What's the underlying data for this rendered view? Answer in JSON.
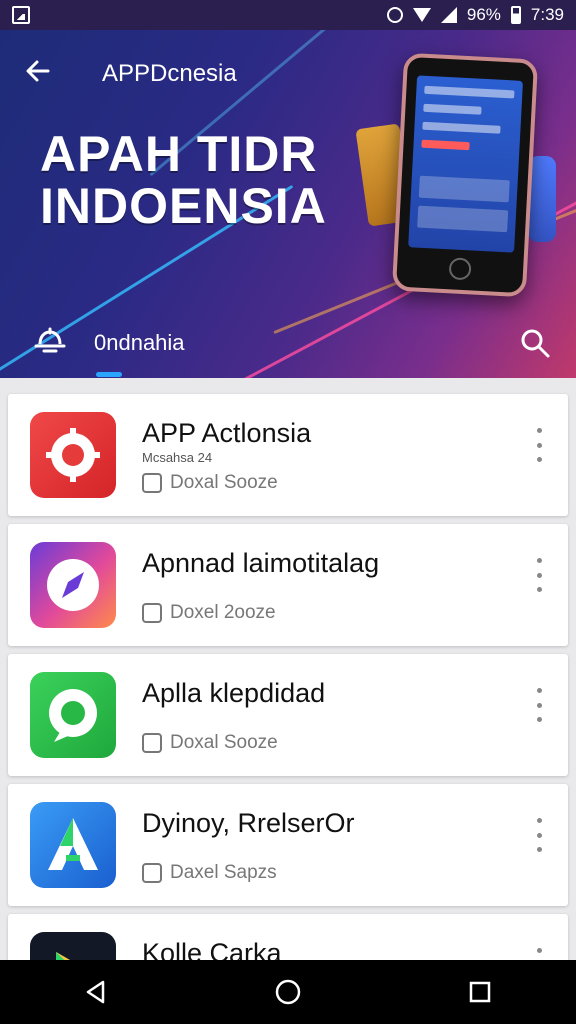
{
  "status": {
    "battery_text": "96%",
    "time": "7:39"
  },
  "header": {
    "title": "APPDcnesia",
    "hero_line1": "APAH TIDR",
    "hero_line2": "INDOENSIA",
    "tab_label": "0ndnahia"
  },
  "apps": [
    {
      "name": "APP Actlonsia",
      "sub": "Mcsahsa 24",
      "meta": "Doxal Sooze",
      "colors": [
        "#f04848",
        "#d42428"
      ]
    },
    {
      "name": "Apnnad laimotitalag",
      "sub": "",
      "meta": "Doxel 2ooze",
      "colors": [
        "#8a3bd8",
        "#ff6b6b"
      ]
    },
    {
      "name": "Aplla klepdidad",
      "sub": "",
      "meta": "Doxal Sooze",
      "colors": [
        "#3bd25b",
        "#1fa83c"
      ]
    },
    {
      "name": "Dyinoy, RrelserOr",
      "sub": "",
      "meta": "Daxel Sapzs",
      "colors": [
        "#2d8cf0",
        "#1a5fd0"
      ]
    },
    {
      "name": "Kolle Carka",
      "sub": "",
      "meta": "",
      "colors": [
        "#121826",
        "#000000"
      ]
    }
  ]
}
